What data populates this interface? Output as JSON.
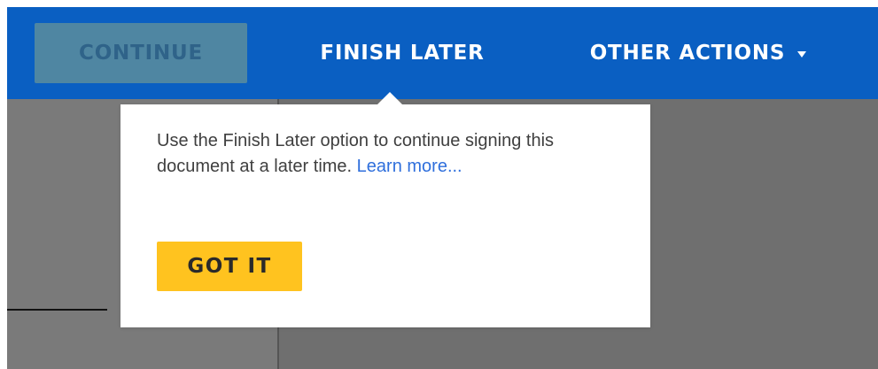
{
  "toolbar": {
    "continue_label": "CONTINUE",
    "finish_later_label": "FINISH LATER",
    "other_actions_label": "OTHER ACTIONS",
    "other_actions_icon": "caret-down-icon",
    "background_color": "#0a5fc2"
  },
  "tooltip": {
    "message": "Use the Finish Later option to continue signing this document at a later time. ",
    "learn_more_label": "Learn more...",
    "got_it_label": "GOT IT",
    "link_color": "#2f6fdc",
    "button_color": "#ffc31f"
  }
}
